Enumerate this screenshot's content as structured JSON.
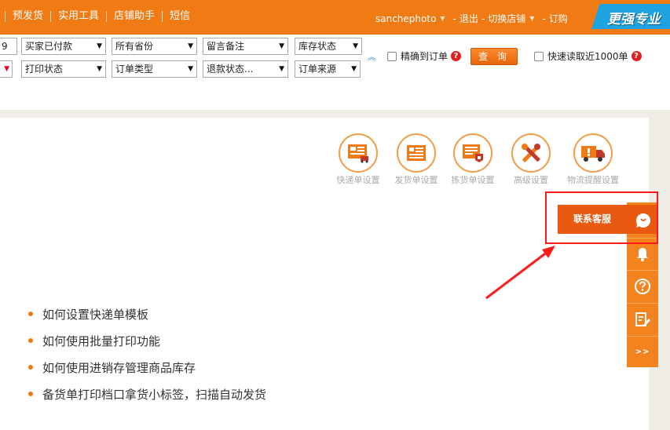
{
  "topnav": {
    "items": [
      "预发货",
      "实用工具",
      "店铺助手",
      "短信"
    ]
  },
  "userbar": {
    "username": "sanchephoto",
    "logout": "退出",
    "switch_shop": "切换店铺",
    "subscribe": "订购",
    "sep": "-"
  },
  "promo": {
    "text": "更强专业"
  },
  "filters": {
    "row1": {
      "partial": "9",
      "status": "买家已付款",
      "province": "所有省份",
      "remark": "留言备注",
      "stock": "库存状态"
    },
    "row2": {
      "print_status": "打印状态",
      "order_type": "订单类型",
      "refund": "退款状态...",
      "source": "订单来源"
    },
    "exact_match_label": "精确到订单",
    "query_button": "查 询",
    "fast_read_label": "快速读取近1000单",
    "help_glyph": "?"
  },
  "tools": [
    {
      "label": "快递单设置",
      "icon": "express-sheet-icon"
    },
    {
      "label": "发货单设置",
      "icon": "delivery-sheet-icon"
    },
    {
      "label": "拣货单设置",
      "icon": "picking-sheet-icon"
    },
    {
      "label": "高级设置",
      "icon": "tools-icon"
    },
    {
      "label": "物流提醒设置",
      "icon": "truck-alert-icon"
    }
  ],
  "links": [
    "如何设置快递单模板",
    "如何使用批量打印功能",
    "如何使用进销存管理商品库存",
    "备货单打印档口拿货小标签，扫描自动发货"
  ],
  "sidebar": {
    "contact_label": "联系客服",
    "more_label": ">>"
  },
  "colors": {
    "brand_orange": "#f07a13",
    "sidebar_orange": "#f3831f",
    "contact_button": "#e9590f",
    "highlight_red": "#ff1a1a",
    "promo_blue": "#1fa3e0"
  }
}
